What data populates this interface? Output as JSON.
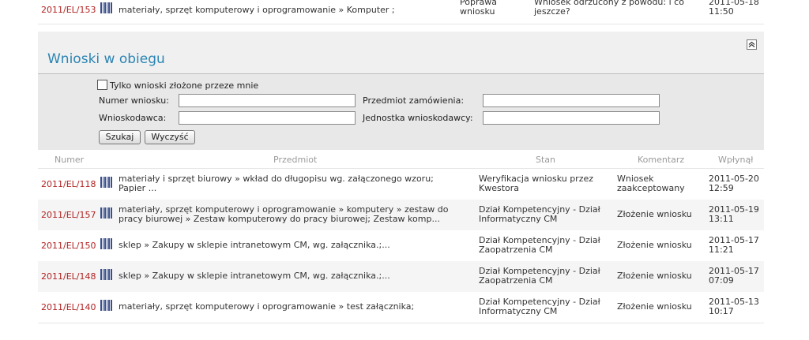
{
  "top_row": {
    "number": "2011/EL/153",
    "subject": "materiały, sprzęt komputerowy i oprogramowanie » Komputer ;",
    "status_line1": "Poprawa",
    "status_line2": "wniosku",
    "comment_line1": "Wniosek odrzucony z powodu: i co",
    "comment_line2": "jeszcze?",
    "date": "2011-05-18",
    "time": "11:50"
  },
  "section": {
    "title": "Wnioski w obiegu",
    "collapse_icon": "double-chevron-up-icon"
  },
  "filter": {
    "only_mine_label": "Tylko wnioski złożone przeze mnie",
    "number_label": "Numer wniosku:",
    "number_value": "",
    "applicant_label": "Wnioskodawca:",
    "applicant_value": "",
    "subject_label": "Przedmiot zamówienia:",
    "subject_value": "",
    "unit_label": "Jednostka wnioskodawcy:",
    "unit_value": "",
    "search_button": "Szukaj",
    "clear_button": "Wyczyść"
  },
  "table": {
    "headers": [
      "Numer",
      "Przedmiot",
      "Stan",
      "Komentarz",
      "Wpłynął"
    ],
    "rows": [
      {
        "number": "2011/EL/118",
        "subject_line1": "materiały i sprzęt biurowy » wkład do długopisu wg. załączonego wzoru;",
        "subject_line2": "Papier ...",
        "status_line1": "Weryfikacja wniosku przez",
        "status_line2": "Kwestora",
        "comment_line1": "Wniosek",
        "comment_line2": "zaakceptowany",
        "date": "2011-05-20",
        "time": "12:59"
      },
      {
        "number": "2011/EL/157",
        "subject_line1": "materiały, sprzęt komputerowy i oprogramowanie » komputery » zestaw do",
        "subject_line2": "pracy biurowej » Zestaw komputerowy do pracy biurowej; Zestaw komp...",
        "status_line1": "Dział Kompetencyjny - Dział",
        "status_line2": "Informatyczny CM",
        "comment_line1": "Złożenie wniosku",
        "comment_line2": "",
        "date": "2011-05-19",
        "time": "13:11"
      },
      {
        "number": "2011/EL/150",
        "subject_line1": "sklep » Zakupy w sklepie intranetowym CM, wg. załącznika.;...",
        "subject_line2": "",
        "status_line1": "Dział Kompetencyjny - Dział",
        "status_line2": "Zaopatrzenia CM",
        "comment_line1": "Złożenie wniosku",
        "comment_line2": "",
        "date": "2011-05-17",
        "time": "11:21"
      },
      {
        "number": "2011/EL/148",
        "subject_line1": "sklep » Zakupy w sklepie intranetowym CM, wg. załącznika.;...",
        "subject_line2": "",
        "status_line1": "Dział Kompetencyjny - Dział",
        "status_line2": "Zaopatrzenia CM",
        "comment_line1": "Złożenie wniosku",
        "comment_line2": "",
        "date": "2011-05-17",
        "time": "07:09"
      },
      {
        "number": "2011/EL/140",
        "subject_line1": "materiały, sprzęt komputerowy i oprogramowanie » test załącznika;",
        "subject_line2": "",
        "status_line1": "Dział Kompetencyjny - Dział",
        "status_line2": "Informatyczny CM",
        "comment_line1": "Złożenie wniosku",
        "comment_line2": "",
        "date": "2011-05-13",
        "time": "10:17"
      }
    ]
  },
  "colors": {
    "link": "#b22222",
    "title": "#2a84b4",
    "barcode": "#3a4f8a"
  }
}
